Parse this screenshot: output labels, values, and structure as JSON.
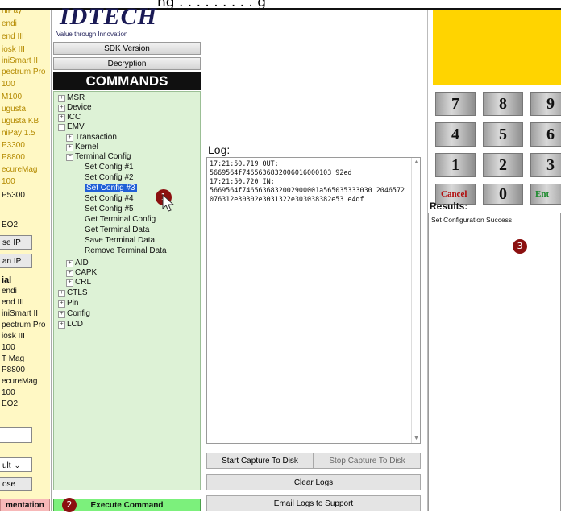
{
  "caption": "ng . . . . . . . . . g",
  "device_list": {
    "items_top": [
      "niPay",
      "endi",
      "end III",
      "iosk III",
      "iniSmart II",
      "pectrum Pro",
      "100",
      "M100",
      "ugusta",
      "ugusta KB",
      "niPay 1.5",
      "P3300",
      "P8800",
      "ecureMag",
      "100"
    ],
    "item_p5300": "P5300",
    "item_eo2": "EO2",
    "btn_use_ip": "se IP",
    "btn_scan_ip": "an IP",
    "section_serial": "ial",
    "items_serial": [
      "endi",
      "end III",
      "iniSmart II",
      "pectrum Pro",
      "iosk III",
      "100",
      "T Mag",
      "P8800",
      "ecureMag",
      "100",
      "EO2"
    ],
    "select_value": "ult",
    "btn_close": "ose"
  },
  "logo": {
    "brand": "IDTECH",
    "tagline": "Value through Innovation"
  },
  "buttons": {
    "sdk_version": "SDK Version",
    "decryption": "Decryption",
    "execute": "Execute Command",
    "documentation": "mentation"
  },
  "commands_header": "COMMANDS",
  "tree": {
    "msr": "MSR",
    "device": "Device",
    "icc": "ICC",
    "emv": "EMV",
    "transaction": "Transaction",
    "kernel": "Kernel",
    "terminal_config": "Terminal Config",
    "set_config_1": "Set Config #1",
    "set_config_2": "Set Config #2",
    "set_config_3": "Set Config #3",
    "set_config_4": "Set Config #4",
    "set_config_5": "Set Config #5",
    "get_terminal_config": "Get Terminal Config",
    "get_terminal_data": "Get Terminal Data",
    "save_terminal_data": "Save Terminal Data",
    "remove_terminal_data": "Remove Terminal Data",
    "aid": "AID",
    "capk": "CAPK",
    "crl": "CRL",
    "ctls": "CTLS",
    "pin": "Pin",
    "config": "Config",
    "lcd": "LCD"
  },
  "log": {
    "label": "Log:",
    "lines": [
      "17:21:50.719 OUT:",
      "5669564f7465636832006016000103 92ed",
      "17:21:50.720 IN:",
      "5669564f7465636832002900001a565035333030 2046572076312e30302e3031322e303038382e53 e4df"
    ],
    "start_capture": "Start Capture To Disk",
    "stop_capture": "Stop Capture To Disk",
    "clear_logs": "Clear Logs",
    "email_logs": "Email Logs to Support"
  },
  "keypad": {
    "keys": [
      "7",
      "8",
      "9",
      "4",
      "5",
      "6",
      "1",
      "2",
      "3"
    ],
    "cancel": "Cancel",
    "zero": "0",
    "enter": "Ent"
  },
  "results": {
    "label": "Results:",
    "text": "Set Configuration Success"
  },
  "markers": [
    "1",
    "2",
    "3"
  ],
  "colors": {
    "accent_yellow": "#ffd400",
    "tree_bg": "#ddf2d6",
    "execute_bg": "#7cf07c",
    "marker": "#8b1010",
    "selection": "#1f5fd6"
  }
}
